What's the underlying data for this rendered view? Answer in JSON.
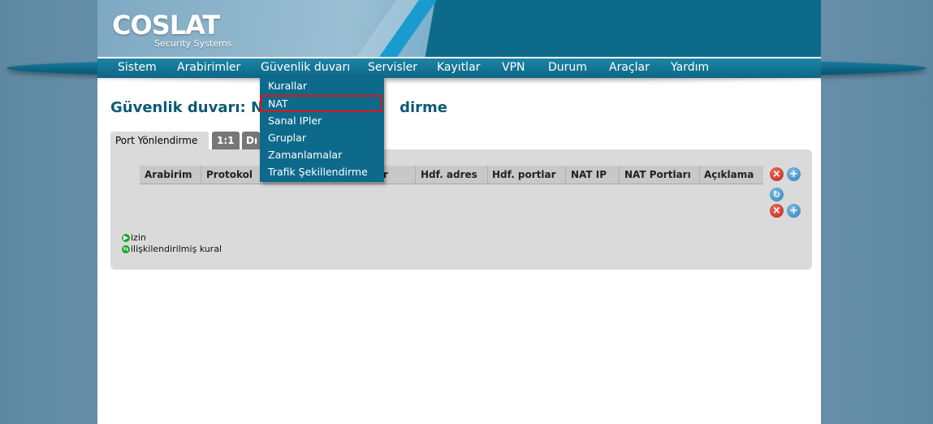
{
  "header": {
    "logo": "COSLAT",
    "logo_sub": "Security Systems"
  },
  "nav": {
    "items": [
      "Sistem",
      "Arabirimler",
      "Güvenlik duvarı",
      "Servisler",
      "Kayıtlar",
      "VPN",
      "Durum",
      "Araçlar",
      "Yardım"
    ]
  },
  "dropdown": {
    "items": [
      "Kurallar",
      "NAT",
      "Sanal IPler",
      "Gruplar",
      "Zamanlamalar",
      "Trafik Şekillendirme"
    ],
    "highlighted_index": 1
  },
  "page": {
    "title": "Güvenlik duvarı: NAT: Port Yönlendirme",
    "title_left": "Güvenlik duvarı: N",
    "title_right": "dirme"
  },
  "tabs": [
    "Port Yönlendirme",
    "1:1",
    "Dı"
  ],
  "table": {
    "columns": [
      "Arabirim",
      "Protokol",
      "tlar",
      "Hdf. adres",
      "Hdf. portlar",
      "NAT IP",
      "NAT Portları",
      "Açıklama"
    ]
  },
  "legend": {
    "pass": "izin",
    "linked": "ilişkilendirilmiş kural"
  },
  "icons": {
    "delete": "delete-icon",
    "add": "add-icon",
    "refresh": "refresh-icon",
    "pass": "play-icon",
    "linked": "link-icon"
  },
  "colors": {
    "header": "#0e6a8a",
    "title": "#0e5a78",
    "highlight_border": "#e01414",
    "panel": "#dadada"
  }
}
